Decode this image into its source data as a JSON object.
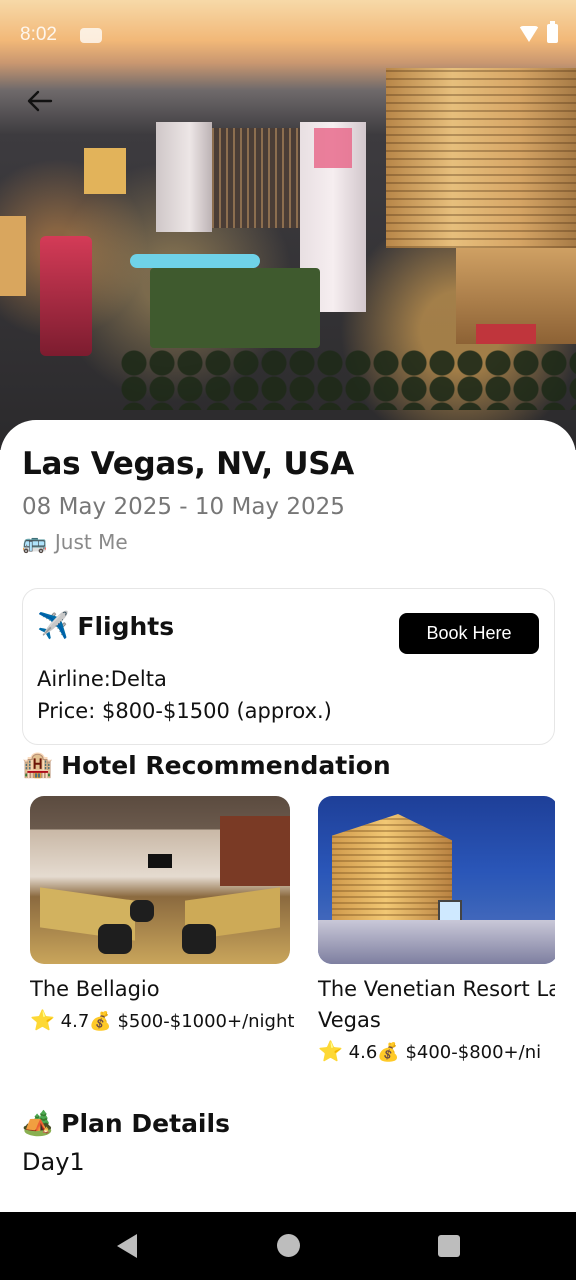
{
  "status_bar": {
    "time": "8:02"
  },
  "trip": {
    "location": "Las Vegas, NV, USA",
    "dates": "08 May 2025 - 10 May 2025",
    "travelers_icon": "bus-emoji",
    "travelers": "Just Me"
  },
  "flights": {
    "icon": "airplane-emoji",
    "title": "Flights",
    "book_label": "Book Here",
    "airline": "Airline:Delta",
    "price": "Price: $800-$1500 (approx.)"
  },
  "hotels": {
    "icon": "hotel-emoji",
    "title": "Hotel Recommendation",
    "items": [
      {
        "name": "The Bellagio",
        "rating": "4.7",
        "price": "$500-$1000+/night"
      },
      {
        "name": "The Venetian Resort Las Vegas",
        "rating": "4.6",
        "price": "$400-$800+/ni"
      }
    ]
  },
  "plan": {
    "icon": "camping-emoji",
    "title": "Plan Details",
    "day": "Day1"
  },
  "colors": {
    "primary_button": "#000000",
    "star": "#f4b400",
    "subtext": "#777777"
  }
}
